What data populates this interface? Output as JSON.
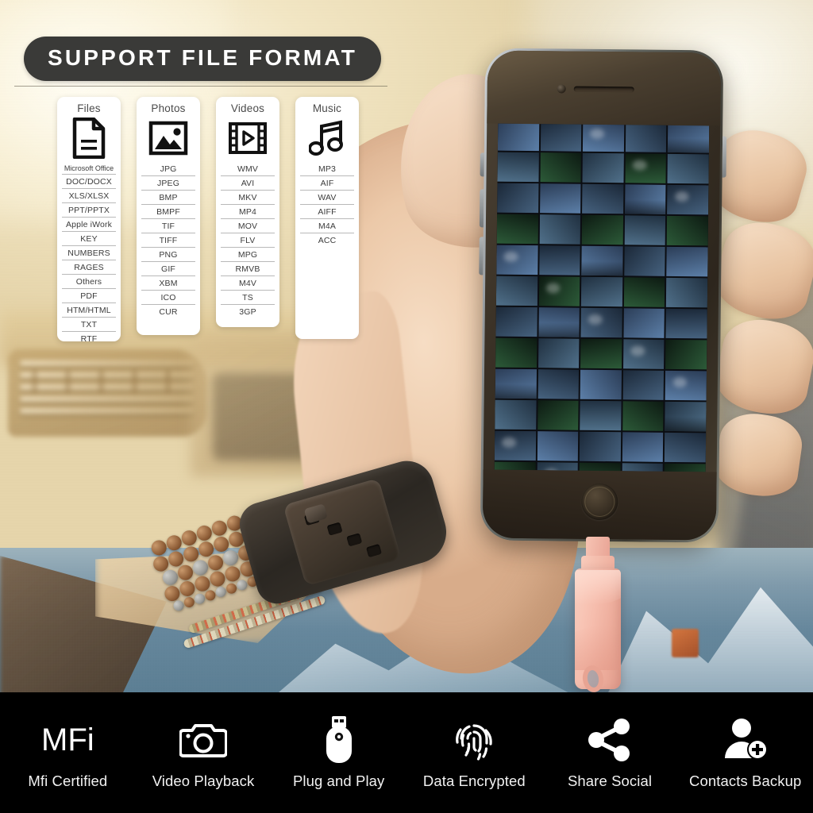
{
  "header": {
    "title": "SUPPORT FILE FORMAT"
  },
  "colors": {
    "badge_background": "#3a3a38",
    "badge_text": "#ffffff",
    "card_background": "#ffffff",
    "feature_bar_background": "#000000",
    "usb_drive": "#f5b5a5",
    "background_warm": "#e8dcc4"
  },
  "format_cards": [
    {
      "title": "Files",
      "icon": "document-icon",
      "formats": [
        "Microsoft Office",
        "DOC/DOCX",
        "XLS/XLSX",
        "PPT/PPTX",
        "Apple iWork",
        "KEY",
        "NUMBERS",
        "RAGES",
        "Others",
        "PDF",
        "HTM/HTML",
        "TXT",
        "RTF"
      ]
    },
    {
      "title": "Photos",
      "icon": "image-icon",
      "formats": [
        "JPG",
        "JPEG",
        "BMP",
        "BMPF",
        "TIF",
        "TIFF",
        "PNG",
        "GIF",
        "XBM",
        "ICO",
        "CUR"
      ]
    },
    {
      "title": "Videos",
      "icon": "film-play-icon",
      "formats": [
        "WMV",
        "AVI",
        "MKV",
        "MP4",
        "MOV",
        "FLV",
        "MPG",
        "RMVB",
        "M4V",
        "TS",
        "3GP"
      ]
    },
    {
      "title": "Music",
      "icon": "music-note-icon",
      "formats": [
        "MP3",
        "AIF",
        "WAV",
        "AIFF",
        "M4A",
        "ACC"
      ]
    }
  ],
  "features": [
    {
      "icon": "mfi-wordmark-icon",
      "glyph": "MFi",
      "label": "Mfi Certified"
    },
    {
      "icon": "camera-icon",
      "label": "Video Playback"
    },
    {
      "icon": "usb-drive-icon",
      "label": "Plug and Play"
    },
    {
      "icon": "fingerprint-icon",
      "label": "Data Encrypted"
    },
    {
      "icon": "share-icon",
      "label": "Share Social"
    },
    {
      "icon": "contacts-add-icon",
      "label": "Contacts Backup"
    }
  ]
}
